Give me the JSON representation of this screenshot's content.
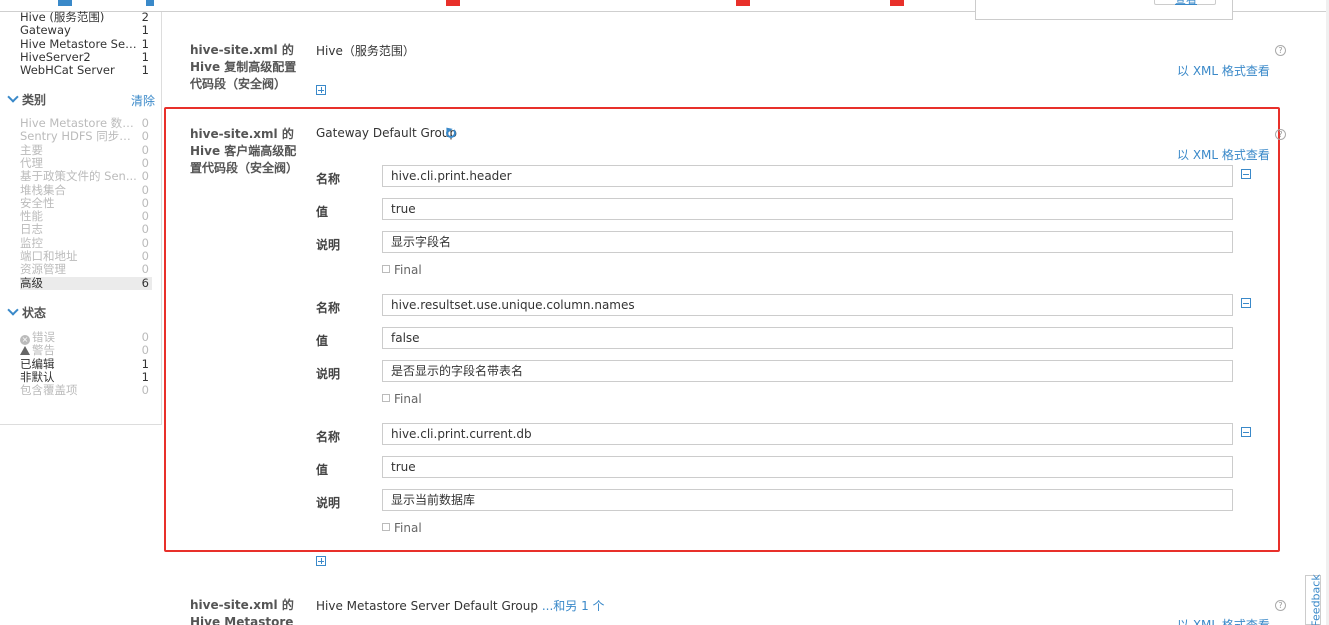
{
  "sidebar": {
    "scope_items": [
      {
        "label": "Hive (服务范围)",
        "count": "2"
      },
      {
        "label": "Gateway",
        "count": "1"
      },
      {
        "label": "Hive Metastore Server",
        "count": "1"
      },
      {
        "label": "HiveServer2",
        "count": "1"
      },
      {
        "label": "WebHCat Server",
        "count": "1"
      }
    ],
    "category_heading": "类别",
    "clear_label": "清除",
    "category_items": [
      {
        "label": "Hive Metastore 数据库",
        "count": "0"
      },
      {
        "label": "Sentry HDFS 同步缓存",
        "count": "0"
      },
      {
        "label": "主要",
        "count": "0"
      },
      {
        "label": "代理",
        "count": "0"
      },
      {
        "label": "基于政策文件的 Sen...",
        "count": "0"
      },
      {
        "label": "堆栈集合",
        "count": "0"
      },
      {
        "label": "安全性",
        "count": "0"
      },
      {
        "label": "性能",
        "count": "0"
      },
      {
        "label": "日志",
        "count": "0"
      },
      {
        "label": "监控",
        "count": "0"
      },
      {
        "label": "端口和地址",
        "count": "0"
      },
      {
        "label": "资源管理",
        "count": "0"
      },
      {
        "label": "高级",
        "count": "6"
      }
    ],
    "status_heading": "状态",
    "status_items": [
      {
        "label": "错误",
        "count": "0"
      },
      {
        "label": "警告",
        "count": "0"
      },
      {
        "label": "已编辑",
        "count": "1"
      },
      {
        "label": "非默认",
        "count": "1"
      },
      {
        "label": "包含覆盖项",
        "count": "0"
      }
    ]
  },
  "popup": {
    "button_label": "查看"
  },
  "section1": {
    "title": "hive-site.xml 的 Hive 复制高级配置代码段（安全阀）",
    "scope": "Hive（服务范围）",
    "xml_link": "以 XML 格式查看"
  },
  "section2": {
    "title": "hive-site.xml 的 Hive 客户端高级配置代码段（安全阀）",
    "scope": "Gateway Default Group",
    "xml_link": "以 XML 格式查看",
    "labels": {
      "name": "名称",
      "value": "值",
      "desc": "说明",
      "final": "Final"
    },
    "entries": [
      {
        "name": "hive.cli.print.header",
        "value": "true",
        "desc": "显示字段名"
      },
      {
        "name": "hive.resultset.use.unique.column.names",
        "value": "false",
        "desc": "是否显示的字段名带表名"
      },
      {
        "name": " hive.cli.print.current.db",
        "value": "true",
        "desc": "显示当前数据库"
      }
    ]
  },
  "section3": {
    "title": "hive-site.xml 的 Hive Metastore Server 高",
    "scope": "Hive Metastore Server Default Group",
    "more": "...和另 1 个",
    "xml_link": "以 XML 格式查看"
  },
  "feedback_label": "Feedback",
  "colors": {
    "accent": "#3a89c9",
    "highlight_box": "#e8302a"
  }
}
